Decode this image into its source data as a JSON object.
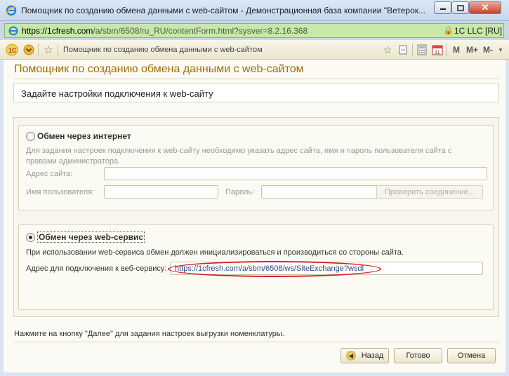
{
  "window": {
    "title": "Помощник по созданию обмена данными с web-сайтом - Демонстрационная база компании \"Ветерок...",
    "min_icon": "minimize-icon",
    "max_icon": "maximize-icon",
    "close_glyph": "✕"
  },
  "address": {
    "scheme_host": "https://1cfresh.com",
    "path": "/a/sbm/6508/ru_RU/contentForm.html?sysver=8.2.16.368",
    "cert_label": "1C LLC [RU]"
  },
  "toolbar": {
    "page_label": "Помощник по созданию обмена данными с web-сайтом",
    "m_label": "M",
    "m_plus_label": "M+",
    "m_minus_label": "M-"
  },
  "form": {
    "title": "Помощник по созданию обмена данными с web-сайтом",
    "subtitle": "Задайте настройки подключения к web-сайту",
    "internet": {
      "radio_label": "Обмен через интернет",
      "help": "Для задания настроек подключения к web-сайту необходимо указать адрес сайта, имя и пароль пользователя сайта с правами администратора.",
      "site_address_label": "Адрес сайта:",
      "site_address_value": "",
      "username_label": "Имя пользователя:",
      "username_value": "",
      "password_label": "Пароль:",
      "password_value": "",
      "check_button": "Проверить соединение..."
    },
    "webservice": {
      "radio_label": "Обмен через web-сервис",
      "help": "При использовании web-сервиса обмен должен инициализироваться и производиться со стороны сайта.",
      "address_label": "Адрес для подключения к веб-сервису:",
      "address_value": "https://1cfresh.com/a/sbm/6508/ws/SiteExchange?wsdl"
    },
    "footnote": "Нажмите на кнопку \"Далее\" для задания настроек выгрузки номенклатуры.",
    "buttons": {
      "back": "Назад",
      "done": "Готово",
      "cancel": "Отмена"
    }
  },
  "colors": {
    "title": "#a06f00",
    "highlight": "#d91f1f",
    "address_bar": "#c7e8a8"
  }
}
